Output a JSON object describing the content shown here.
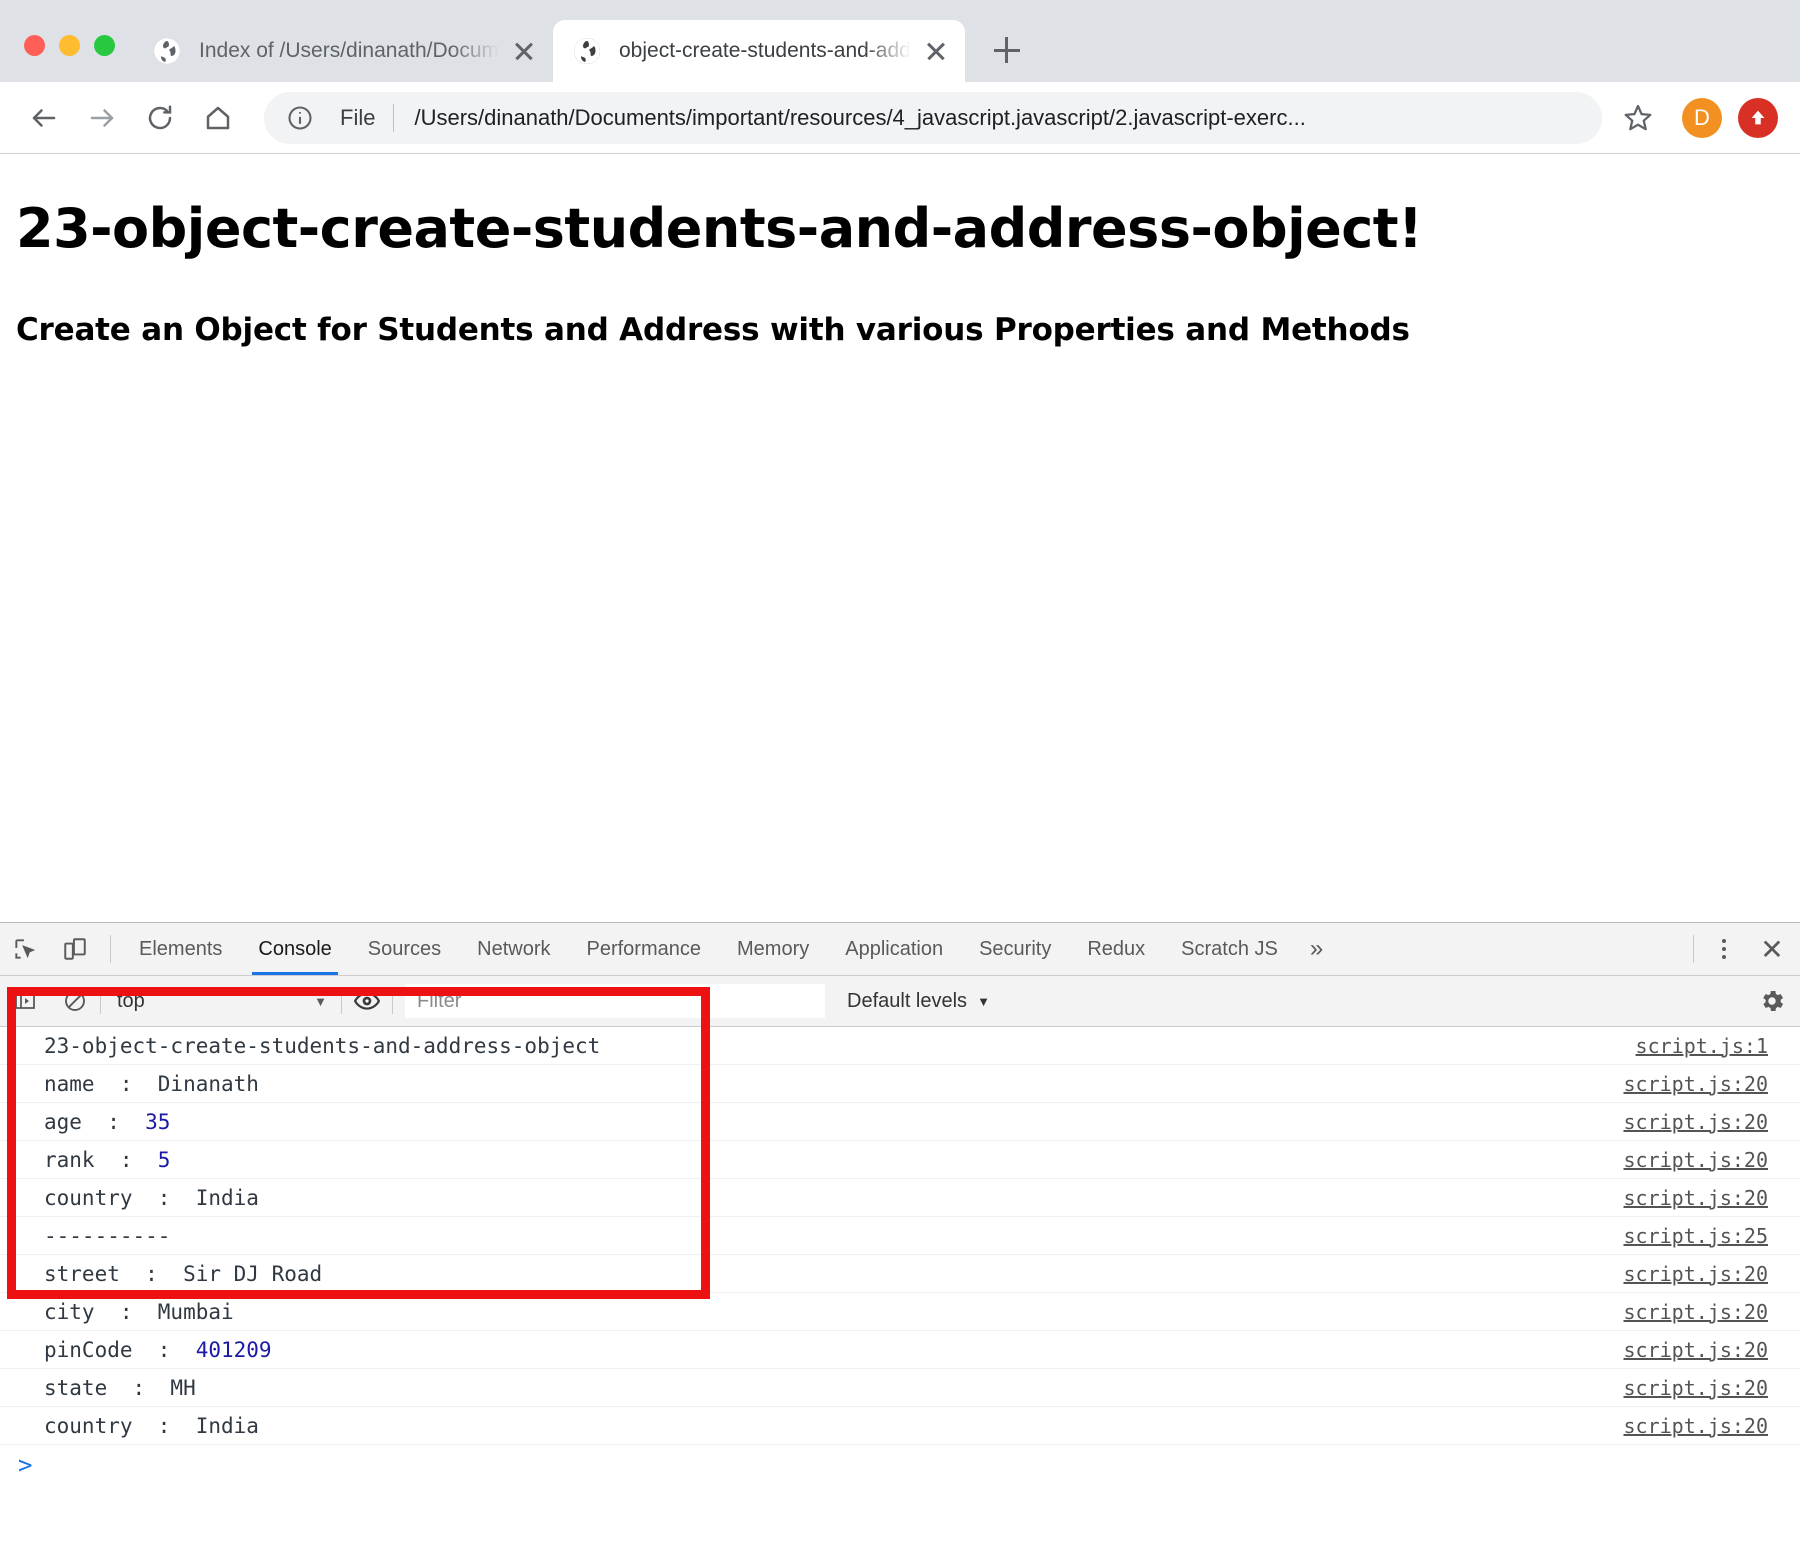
{
  "browser": {
    "window_controls": [
      "close",
      "minimize",
      "maximize"
    ],
    "tabs": [
      {
        "title": "Index of /Users/dinanath/Docum",
        "favicon": "globe-icon",
        "active": false
      },
      {
        "title": "object-create-students-and-add",
        "favicon": "globe-icon",
        "active": true
      }
    ],
    "new_tab_label": "+",
    "nav": {
      "back": "back-arrow",
      "forward": "forward-arrow",
      "reload": "reload-icon",
      "home": "home-icon"
    },
    "omnibox": {
      "info_icon": "info-circle-icon",
      "scheme_label": "File",
      "url": "/Users/dinanath/Documents/important/resources/4_javascript.javascript/2.javascript-exerc...",
      "star_icon": "star-outline-icon"
    },
    "profile": {
      "initial": "D",
      "color": "#f29022"
    },
    "update_badge": {
      "icon": "arrow-up-icon",
      "color": "#d93025"
    }
  },
  "page": {
    "heading": "23-object-create-students-and-address-object!",
    "subheading": "Create an Object for Students and Address with various Properties and Methods"
  },
  "devtools": {
    "left_icons": [
      "inspect-element-icon",
      "device-toolbar-icon"
    ],
    "tabs": [
      {
        "label": "Elements",
        "selected": false
      },
      {
        "label": "Console",
        "selected": true
      },
      {
        "label": "Sources",
        "selected": false
      },
      {
        "label": "Network",
        "selected": false
      },
      {
        "label": "Performance",
        "selected": false
      },
      {
        "label": "Memory",
        "selected": false
      },
      {
        "label": "Application",
        "selected": false
      },
      {
        "label": "Security",
        "selected": false
      },
      {
        "label": "Redux",
        "selected": false
      },
      {
        "label": "Scratch JS",
        "selected": false
      }
    ],
    "more_tabs_label": "»",
    "close_label": "✕",
    "selected_tab_accent": "#1a73e8",
    "filterbar": {
      "sidebar_icon": "show-console-sidebar-icon",
      "clear_icon": "clear-console-icon",
      "context": "top",
      "context_caret": "▼",
      "eye_icon": "live-expression-icon",
      "filter_placeholder": "Filter",
      "filter_value": "",
      "levels": "Default levels",
      "levels_caret": "▼",
      "settings_icon": "gear-icon"
    },
    "console_messages": [
      {
        "text": "23-object-create-students-and-address-object",
        "source": "script.js:1"
      },
      {
        "text": "name  :  Dinanath",
        "source": "script.js:20"
      },
      {
        "text": "age  :  ",
        "num": "35",
        "source": "script.js:20"
      },
      {
        "text": "rank  :  ",
        "num": "5",
        "source": "script.js:20"
      },
      {
        "text": "country  :  India",
        "source": "script.js:20"
      },
      {
        "text": "----------",
        "source": "script.js:25"
      },
      {
        "text": "street  :  Sir DJ Road",
        "source": "script.js:20"
      },
      {
        "text": "city  :  Mumbai",
        "source": "script.js:20"
      },
      {
        "text": "pinCode  :  ",
        "num": "401209",
        "source": "script.js:20"
      },
      {
        "text": "state  :  MH",
        "source": "script.js:20"
      },
      {
        "text": "country  :  India",
        "source": "script.js:20"
      }
    ],
    "prompt": ">",
    "annotation_color": "#ee1111"
  }
}
